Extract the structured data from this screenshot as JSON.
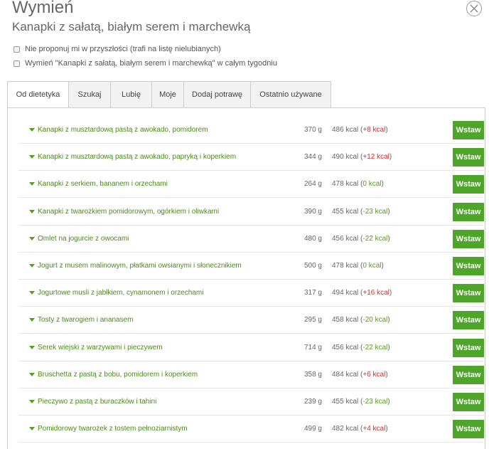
{
  "header": {
    "title": "Wymień",
    "subtitle": "Kanapki z sałatą, białym serem i marchewką"
  },
  "options": [
    {
      "label": "Nie proponuj mi w przyszłości (trafi na listę nielubianych)",
      "checked": false
    },
    {
      "label": "Wymień \"Kanapki z sałatą, białym serem i marchewką\" w całym tygodniu",
      "checked": false
    }
  ],
  "tabs": [
    {
      "label": "Od dietetyka",
      "active": true
    },
    {
      "label": "Szukaj",
      "active": false
    },
    {
      "label": "Lubię",
      "active": false
    },
    {
      "label": "Moje",
      "active": false
    },
    {
      "label": "Dodaj potrawę",
      "active": false
    },
    {
      "label": "Ostatnio używane",
      "active": false
    }
  ],
  "items": [
    {
      "name": "Kanapki z musztardową pastą z awokado, pomidorem",
      "weight": "370 g",
      "kcal": "486 kcal",
      "diff": "+8 kcal",
      "button": "Wstaw"
    },
    {
      "name": "Kanapki z musztardową pastą z awokado, papryką i koperkiem",
      "weight": "344 g",
      "kcal": "490 kcal",
      "diff": "+12 kcal",
      "button": "Wstaw"
    },
    {
      "name": "Kanapki z serkiem, bananem i orzechami",
      "weight": "264 g",
      "kcal": "478 kcal",
      "diff": "0 kcal",
      "button": "Wstaw"
    },
    {
      "name": "Kanapki z twarożkiem pomidorowym, ogórkiem i oliwkami",
      "weight": "390 g",
      "kcal": "455 kcal",
      "diff": "-23 kcal",
      "button": "Wstaw"
    },
    {
      "name": "Omlet na jogurcie z owocami",
      "weight": "480 g",
      "kcal": "456 kcal",
      "diff": "-22 kcal",
      "button": "Wstaw"
    },
    {
      "name": "Jogurt z musem malinowym, płatkami owsianymi i słonecznikiem",
      "weight": "500 g",
      "kcal": "478 kcal",
      "diff": "0 kcal",
      "button": "Wstaw"
    },
    {
      "name": "Jogurtowe musli z jabłkiem, cynamonem i orzechami",
      "weight": "317 g",
      "kcal": "494 kcal",
      "diff": "+16 kcal",
      "button": "Wstaw"
    },
    {
      "name": "Tosty z twarogiem i ananasem",
      "weight": "295 g",
      "kcal": "458 kcal",
      "diff": "-20 kcal",
      "button": "Wstaw"
    },
    {
      "name": "Serek wiejski z warzywami i pieczywem",
      "weight": "714 g",
      "kcal": "456 kcal",
      "diff": "-22 kcal",
      "button": "Wstaw"
    },
    {
      "name": "Bruschetta z pastą z bobu, pomidorem i koperkiem",
      "weight": "358 g",
      "kcal": "484 kcal",
      "diff": "+6 kcal",
      "button": "Wstaw"
    },
    {
      "name": "Pieczywo z pastą z buraczków i tahini",
      "weight": "239 g",
      "kcal": "455 kcal",
      "diff": "-23 kcal",
      "button": "Wstaw"
    },
    {
      "name": "Pomidorowy twarożek z tostem pełnoziarnistym",
      "weight": "499 g",
      "kcal": "482 kcal",
      "diff": "+4 kcal",
      "button": "Wstaw"
    }
  ],
  "colors": {
    "accent_green": "#4ea52a",
    "link_green": "#4a8a1a",
    "diff_up": "#d03030",
    "diff_down": "#5a9a20"
  }
}
